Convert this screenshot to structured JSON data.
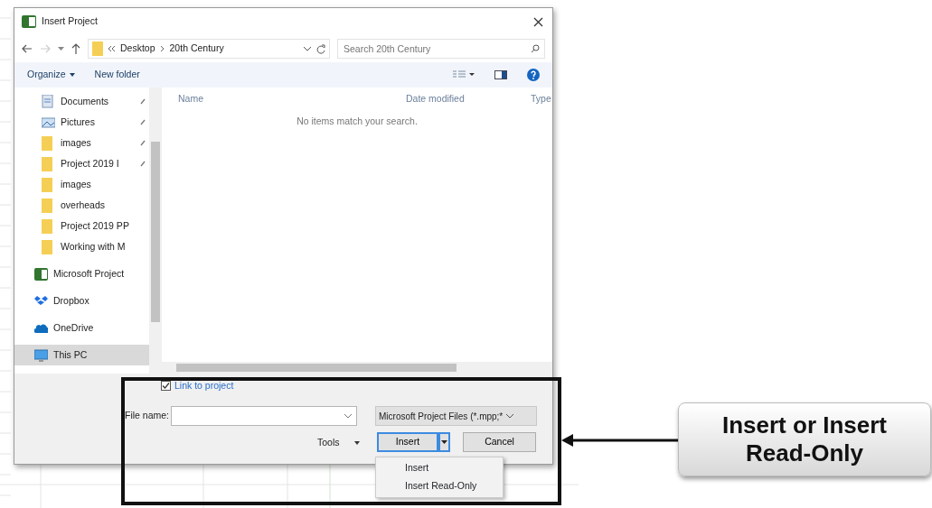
{
  "window": {
    "title": "Insert Project"
  },
  "address_bar": {
    "path": [
      "Desktop",
      "20th Century"
    ]
  },
  "search": {
    "placeholder": "Search 20th Century"
  },
  "toolbar": {
    "organize": "Organize",
    "new_folder": "New folder"
  },
  "sidebar": {
    "items": [
      {
        "label": "Documents",
        "kind": "documents",
        "pinned": true,
        "selected": false
      },
      {
        "label": "Pictures",
        "kind": "pictures",
        "pinned": true,
        "selected": false
      },
      {
        "label": "images",
        "kind": "folder",
        "pinned": true,
        "selected": false
      },
      {
        "label": "Project 2019 I",
        "kind": "folder",
        "pinned": true,
        "selected": false
      },
      {
        "label": "images",
        "kind": "folder",
        "pinned": false,
        "selected": false
      },
      {
        "label": "overheads",
        "kind": "folder",
        "pinned": false,
        "selected": false
      },
      {
        "label": "Project 2019 PP",
        "kind": "folder",
        "pinned": false,
        "selected": false
      },
      {
        "label": "Working with M",
        "kind": "folder",
        "pinned": false,
        "selected": false
      },
      {
        "label": "Microsoft Project",
        "kind": "project",
        "pinned": false,
        "selected": false
      },
      {
        "label": "Dropbox",
        "kind": "dropbox",
        "pinned": false,
        "selected": false
      },
      {
        "label": "OneDrive",
        "kind": "onedrive",
        "pinned": false,
        "selected": false
      },
      {
        "label": "This PC",
        "kind": "pc",
        "pinned": false,
        "selected": true
      }
    ]
  },
  "columns": [
    "Name",
    "Date modified",
    "Type"
  ],
  "empty_message": "No items match your search.",
  "link_to_project": {
    "label": "Link to project",
    "checked": true
  },
  "file_name": {
    "label": "File name:"
  },
  "file_type": {
    "value": "Microsoft Project Files (*.mpp;*"
  },
  "tools": "Tools",
  "buttons": {
    "insert": "Insert",
    "cancel": "Cancel"
  },
  "insert_menu": [
    {
      "label": "Insert"
    },
    {
      "label": "Insert Read-Only"
    }
  ],
  "callout": {
    "text": "Insert or Insert Read-Only"
  }
}
